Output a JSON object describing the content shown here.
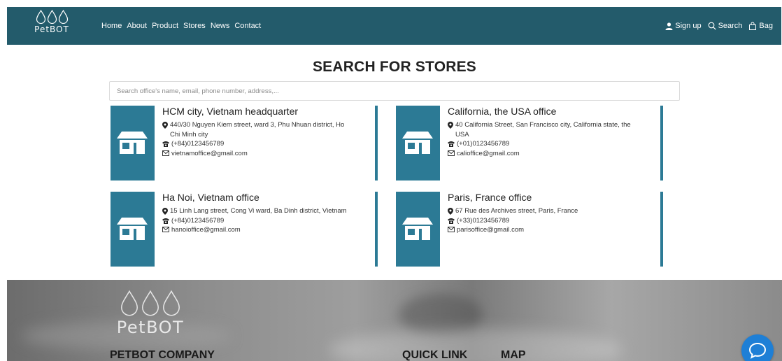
{
  "brand": {
    "name": "PetBOT"
  },
  "nav": {
    "links": [
      "Home",
      "About",
      "Product",
      "Stores",
      "News",
      "Contact"
    ],
    "signup_label": "Sign up",
    "search_label": "Search",
    "bag_label": "Bag"
  },
  "page": {
    "title": "SEARCH FOR STORES",
    "search_placeholder": "Search office's name, email, phone number, address,..."
  },
  "stores": [
    {
      "name": "HCM city, Vietnam headquarter",
      "address": "440/30 Nguyen Kiem street, ward 3, Phu Nhuan district, Ho Chi Minh city",
      "phone": "(+84)0123456789",
      "email": "vietnamoffice@gmail.com"
    },
    {
      "name": "California, the USA office",
      "address": "40 California Street, San Francisco city, California state, the USA",
      "phone": "(+01)0123456789",
      "email": "calioffice@gmail.com"
    },
    {
      "name": "Ha Noi, Vietnam office",
      "address": "15 Linh Lang street, Cong Vi ward, Ba Dinh district, Vietnam",
      "phone": "(+84)0123456789",
      "email": "hanoioffice@gmail.com"
    },
    {
      "name": "Paris, France office",
      "address": "67 Rue des Archives street, Paris, France",
      "phone": "(+33)0123456789",
      "email": "parisoffice@gmail.com"
    }
  ],
  "footer": {
    "company_heading": "PETBOT COMPANY",
    "quick_link_heading": "QUICK LINK",
    "map_heading": "MAP"
  },
  "colors": {
    "navbar": "#235b6b",
    "accent": "#2c7a95",
    "chat": "#1e7fd6"
  }
}
